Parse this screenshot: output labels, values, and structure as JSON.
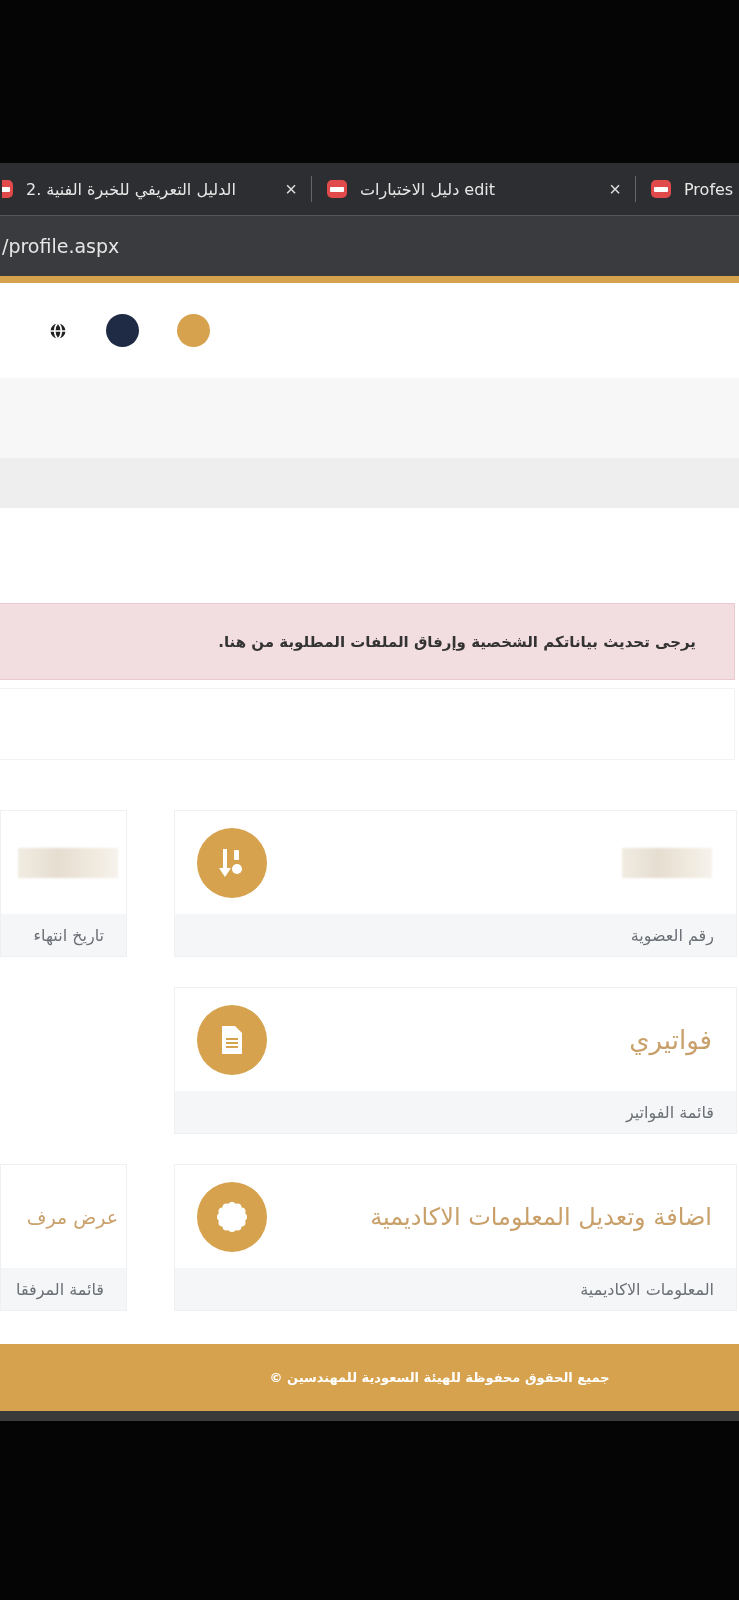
{
  "browser": {
    "tabs": [
      {
        "title": "Profes"
      },
      {
        "title": "دليل الاختبارات edit",
        "close": "×"
      },
      {
        "title": "2. الدليل التعريفي للخبرة الفنية",
        "close": "×"
      }
    ],
    "address": "/profile.aspx"
  },
  "header": {
    "theme_dots": [
      {
        "color": "#1f2b45"
      },
      {
        "color": "#d6a24e"
      }
    ]
  },
  "alert": {
    "message": "يرجى تحديث بياناتكم الشخصية وإرفاق الملفات المطلوبة من هنا."
  },
  "card_rows": [
    {
      "main": {
        "kind": "redacted",
        "label": "رقم العضوية"
      },
      "side": {
        "kind": "redacted",
        "label": "تاريخ انتهاء"
      }
    },
    {
      "main": {
        "kind": "title",
        "title": "فواتيري",
        "label": "قائمة الفواتير"
      }
    },
    {
      "main": {
        "kind": "title",
        "title": "اضافة وتعديل المعلومات الاكاديمية",
        "label": "المعلومات الاكاديمية"
      },
      "side": {
        "kind": "title",
        "title": "عرض مرف",
        "label": "قائمة المرفقا"
      }
    }
  ],
  "footer": {
    "text": "جميع الحقوق محفوظة للهيئة السعودية للمهندسين ©"
  }
}
